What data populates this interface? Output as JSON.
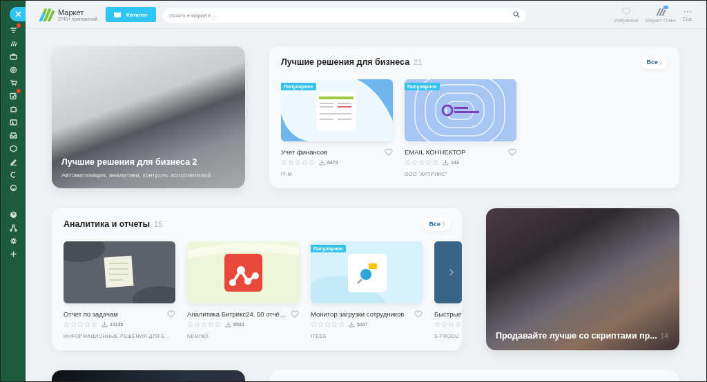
{
  "sidebar": {
    "items": [
      {
        "kind": "close"
      },
      {
        "kind": "filter",
        "badge": true
      },
      {
        "kind": "stripes",
        "badge": false
      },
      {
        "kind": "briefcase",
        "badge": false
      },
      {
        "kind": "target",
        "badge": false
      },
      {
        "kind": "cart",
        "badge": false
      },
      {
        "kind": "tasks",
        "badge": true
      },
      {
        "kind": "puzzle",
        "badge": false
      },
      {
        "kind": "card",
        "badge": false
      },
      {
        "kind": "inbox",
        "badge": false
      },
      {
        "kind": "box",
        "badge": false
      },
      {
        "kind": "pen",
        "badge": false
      },
      {
        "kind": "arc",
        "badge": false
      },
      {
        "kind": "smile",
        "badge": false
      },
      {
        "kind": "help",
        "badge": false
      },
      {
        "kind": "sitemap",
        "badge": false
      },
      {
        "kind": "gear",
        "badge": false
      },
      {
        "kind": "plus",
        "badge": false
      }
    ]
  },
  "header": {
    "logo": {
      "title": "Маркет",
      "subtitle": "2740+ приложений"
    },
    "catalog_button": "Каталог",
    "search": {
      "placeholder": "Искать в маркете ..."
    },
    "actions": [
      {
        "label": "Избранное",
        "kind": "heart",
        "badge": false
      },
      {
        "label": "Маркет Плюс",
        "kind": "plus",
        "badge": true
      },
      {
        "label": "Еще",
        "kind": "more",
        "badge": false
      }
    ]
  },
  "rows": [
    {
      "items": [
        {
          "kind": "promo",
          "photo": {
            "kind": "office"
          },
          "title": "Лучшие решения для бизнеса 2",
          "subtitle": "Автоматизация, аналитика, контроль исполнителей"
        },
        {
          "kind": "section",
          "title": "Лучшие решения для бизнеса",
          "count": "21",
          "all_button": "Все",
          "apps": [
            {
              "kind": "finance",
              "badge": "Популярное",
              "title": "Учет финансов",
              "stars": 0,
              "downloads": "6474",
              "vendor": "IT-M",
              "cut": false
            },
            {
              "kind": "email",
              "badge": "Популярное",
              "title": "EMAIL КОННЕКТОР",
              "stars": 0,
              "downloads": "143",
              "vendor": "ООО \"АРТРИКС\"",
              "cut": false
            }
          ]
        }
      ]
    },
    {
      "items": [
        {
          "kind": "section",
          "title": "Аналитика и отчеты",
          "count": "15",
          "all_button": "Все",
          "apps": [
            {
              "kind": "tasks",
              "title": "Отчет по задачам",
              "stars": 0,
              "downloads": "13135",
              "vendor": "ИНФОРМАЦИОННЫЕ РЕШЕНИЯ ДЛЯ Б...",
              "cut": false
            },
            {
              "kind": "analytics",
              "title": "Аналитика Битрикс24. 50 отчё...",
              "stars": 0,
              "downloads": "8533",
              "vendor": "NEMINO",
              "cut": false
            },
            {
              "kind": "monitor",
              "badge": "Популярное",
              "title": "Монитор загрузки сотрудников",
              "stars": 0,
              "downloads": "5167",
              "vendor": "ITEES",
              "cut": false
            },
            {
              "kind": "dark",
              "title": "Быстрые",
              "stars": 0,
              "vendor": "S-PRODU",
              "cut": true
            }
          ]
        },
        {
          "kind": "promo",
          "photo": {
            "kind": "meeting"
          },
          "title": "Продавайте лучше со скриптами пр...",
          "count": "14"
        }
      ]
    },
    {
      "items": [
        {
          "kind": "promo",
          "photo": {
            "kind": "phones"
          }
        },
        {
          "kind": "section"
        }
      ]
    }
  ]
}
